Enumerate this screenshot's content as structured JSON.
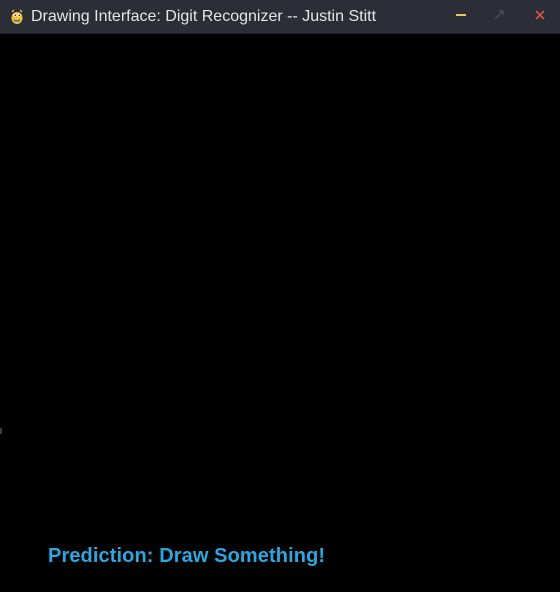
{
  "window": {
    "title": "Drawing Interface: Digit Recognizer -- Justin Stitt",
    "icons": {
      "app": "pygame-snake-icon",
      "minimize": "minimize-icon",
      "maximize": "maximize-icon",
      "close": "close-icon"
    },
    "colors": {
      "titlebar": "#2b2e37",
      "minimize": "#e8c46a",
      "maximize_disabled": "#4a4d55",
      "close": "#d9534f"
    }
  },
  "canvas": {
    "background": "#000000",
    "prediction_text": "Prediction: Draw Something!",
    "prediction_color": "#27a9e1"
  }
}
